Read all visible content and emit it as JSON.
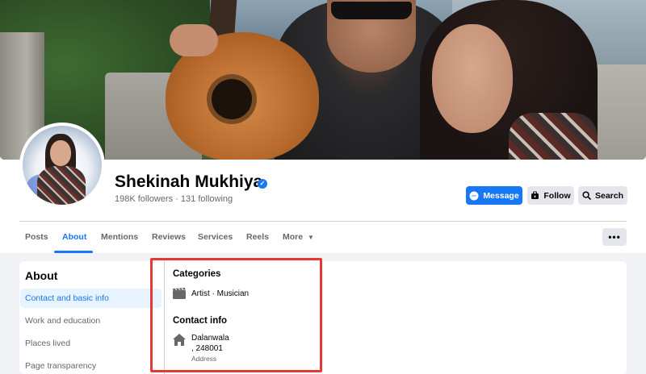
{
  "profile": {
    "name": "Shekinah Mukhiya",
    "stats": "198K followers · 131 following",
    "verified_icon": "verified-badge-icon"
  },
  "actions": {
    "message_label": "Message",
    "follow_label": "Follow",
    "search_label": "Search"
  },
  "tabs": [
    {
      "label": "Posts",
      "active": false
    },
    {
      "label": "About",
      "active": true
    },
    {
      "label": "Mentions",
      "active": false
    },
    {
      "label": "Reviews",
      "active": false
    },
    {
      "label": "Services",
      "active": false
    },
    {
      "label": "Reels",
      "active": false
    },
    {
      "label": "More",
      "active": false
    }
  ],
  "more_menu_glyph": "•••",
  "about": {
    "title": "About",
    "sidebar": [
      {
        "label": "Contact and basic info",
        "active": true
      },
      {
        "label": "Work and education",
        "active": false
      },
      {
        "label": "Places lived",
        "active": false
      },
      {
        "label": "Page transparency",
        "active": false
      }
    ],
    "categories": {
      "title": "Categories",
      "value": "Artist · Musician",
      "icon": "clapperboard-icon"
    },
    "contact": {
      "title": "Contact info",
      "address_line1": "Dalanwala",
      "address_line2": ", 248001",
      "address_label": "Address",
      "icon": "home-icon"
    }
  },
  "colors": {
    "accent": "#1877f2",
    "highlight": "#e53935"
  }
}
